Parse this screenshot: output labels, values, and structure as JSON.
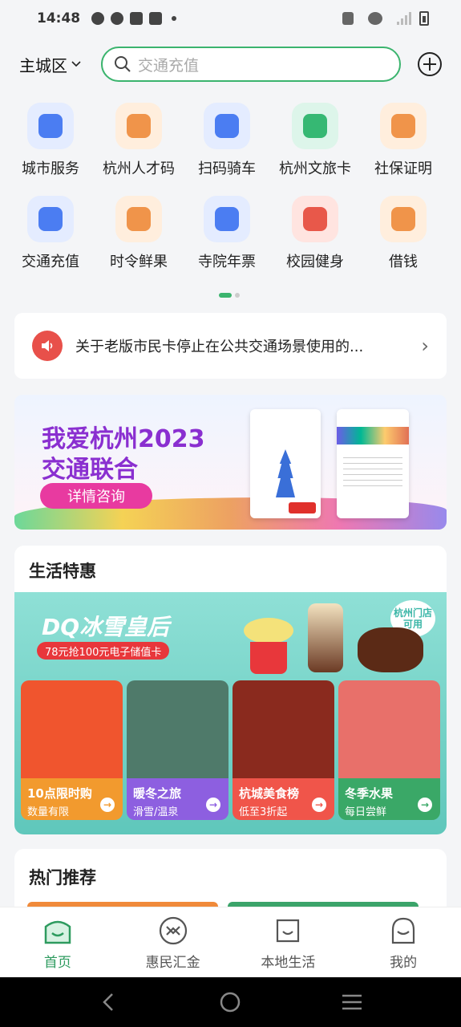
{
  "status_bar": {
    "time": "14:48"
  },
  "header": {
    "city": "主城区",
    "search_placeholder": "交通充值"
  },
  "grid": [
    {
      "label": "城市服务",
      "icon": "city-building-icon",
      "bg": "#e4ecff",
      "fg": "#4b7df2"
    },
    {
      "label": "杭州人才码",
      "icon": "talent-code-icon",
      "bg": "#ffeedd",
      "fg": "#f0944a"
    },
    {
      "label": "扫码骑车",
      "icon": "bike-icon",
      "bg": "#e4ecff",
      "fg": "#4b7df2"
    },
    {
      "label": "杭州文旅卡",
      "icon": "travel-card-icon",
      "bg": "#ddf5ea",
      "fg": "#36b873"
    },
    {
      "label": "社保证明",
      "icon": "certificate-icon",
      "bg": "#ffeedd",
      "fg": "#f0944a"
    },
    {
      "label": "交通充值",
      "icon": "transit-topup-icon",
      "bg": "#e4ecff",
      "fg": "#4b7df2"
    },
    {
      "label": "时令鲜果",
      "icon": "fruit-icon",
      "bg": "#ffeedd",
      "fg": "#f0944a"
    },
    {
      "label": "寺院年票",
      "icon": "temple-icon",
      "bg": "#e4ecff",
      "fg": "#4b7df2"
    },
    {
      "label": "校园健身",
      "icon": "basketball-icon",
      "bg": "#ffe4e0",
      "fg": "#e8584a"
    },
    {
      "label": "借钱",
      "icon": "money-bag-icon",
      "bg": "#ffeedd",
      "fg": "#f0944a"
    }
  ],
  "notice": {
    "text": "关于老版市民卡停止在公共交通场景使用的..."
  },
  "banner": {
    "title_line1": "我爱杭州2023",
    "title_line2": "交通联合",
    "button": "详情咨询"
  },
  "life_deals": {
    "title": "生活特惠",
    "promo": {
      "title": "DQ冰雪皇后",
      "subtitle": "78元抢100元电子储值卡",
      "tag": "杭州门店可用"
    },
    "tiles": [
      {
        "title": "10点限时购",
        "subtitle": "数量有限",
        "color": "#f29a2e",
        "img": "#f0552e"
      },
      {
        "title": "暖冬之旅",
        "subtitle": "滑雪/温泉",
        "color": "#8d5fe0",
        "img": "#4f7a6a"
      },
      {
        "title": "杭城美食榜",
        "subtitle": "低至3折起",
        "color": "#f0554a",
        "img": "#8a2a1e"
      },
      {
        "title": "冬季水果",
        "subtitle": "每日尝鲜",
        "color": "#3aa867",
        "img": "#e8706a"
      }
    ]
  },
  "hot": {
    "title": "热门推荐"
  },
  "tabs": [
    {
      "label": "首页",
      "active": true
    },
    {
      "label": "惠民汇金",
      "active": false
    },
    {
      "label": "本地生活",
      "active": false
    },
    {
      "label": "我的",
      "active": false
    }
  ],
  "colors": {
    "accent": "#3bb46e",
    "active_tab": "#2e9b5f"
  }
}
